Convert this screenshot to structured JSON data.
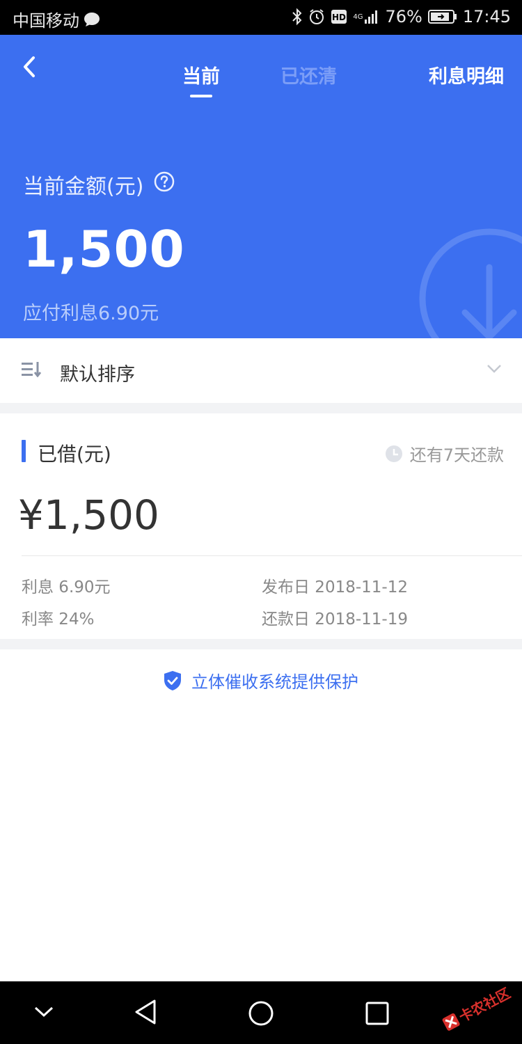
{
  "status_bar": {
    "carrier": "中国移动",
    "network": "4G",
    "battery": "76%",
    "time": "17:45"
  },
  "header": {
    "back_icon": "chevron-left-icon",
    "tabs": [
      {
        "label": "当前",
        "active": true
      },
      {
        "label": "已还清",
        "active": false
      },
      {
        "label": "利息明细",
        "active": false
      }
    ],
    "amount_label": "当前金额(元)",
    "amount_value": "1,500",
    "interest_due": "应付利息6.90元",
    "accent_color": "#3c6ff0"
  },
  "sort": {
    "label": "默认排序",
    "icon": "sort-icon",
    "dropdown_icon": "chevron-down-icon"
  },
  "loan_card": {
    "title": "已借(元)",
    "due_text": "还有7天还款",
    "amount": "¥1,500",
    "interest": "利息 6.90元",
    "rate": "利率 24%",
    "publish_date": "发布日 2018-11-12",
    "repay_date": "还款日 2018-11-19"
  },
  "footer_notice": {
    "text": "立体催收系统提供保护",
    "icon": "shield-check-icon"
  },
  "watermark": {
    "text": "卡农社区"
  }
}
